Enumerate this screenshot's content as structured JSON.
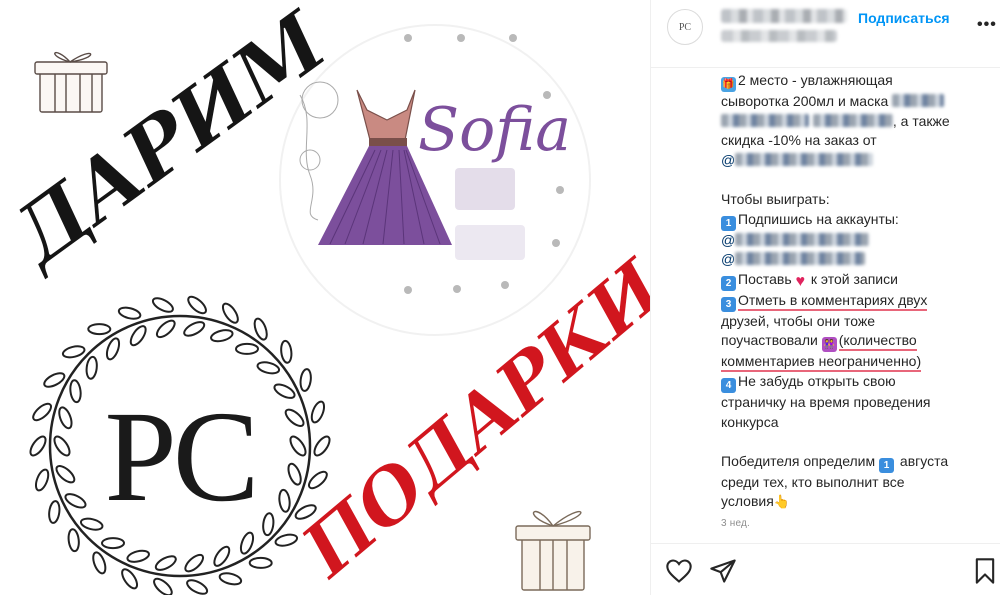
{
  "image": {
    "text_top": "ДАРИМ",
    "brand_name": "Sofia",
    "monogram": "PC",
    "text_bottom": "ПОДАРКИ",
    "colors": {
      "dark_text": "#1a1a1a",
      "purple": "#7c4f9c",
      "red": "#d1161e",
      "dress_top": "#c98a82"
    }
  },
  "header": {
    "follow_label": "Подписаться",
    "avatar_text": "PC",
    "more_icon": "more-icon"
  },
  "caption": {
    "l1": "2 место - увлажняющая",
    "l2a": "сыворотка 200мл и маска ",
    "l3b": ", а также",
    "l4": "скидка -10% на заказ от",
    "l5": "@",
    "l7": "Чтобы выиграть:",
    "l8": "Подпишись на аккаунты:",
    "l9": "@",
    "l10": "@",
    "l11a": "Поставь ",
    "l11b": " к этой записи",
    "l12": "Отметь в комментариях двух",
    "l13": "друзей, чтобы они тоже",
    "l14a": "поучаствовали ",
    "l14b": "(количество",
    "l15": "комментариев неограниченно)",
    "l16": "Не забудь открыть свою",
    "l17": "страничку на время проведения",
    "l18": "конкурса",
    "l20a": "Победителя определим ",
    "l20b": " августа",
    "l21": "среди тех, кто выполнит все",
    "l22": "условия",
    "keycaps": {
      "k1": "1",
      "k2": "2",
      "k3": "3",
      "k4": "4",
      "k5": "1"
    }
  },
  "timestamp": "3 нед.",
  "actions": [
    "heart-icon",
    "share-icon",
    "bookmark-icon"
  ]
}
